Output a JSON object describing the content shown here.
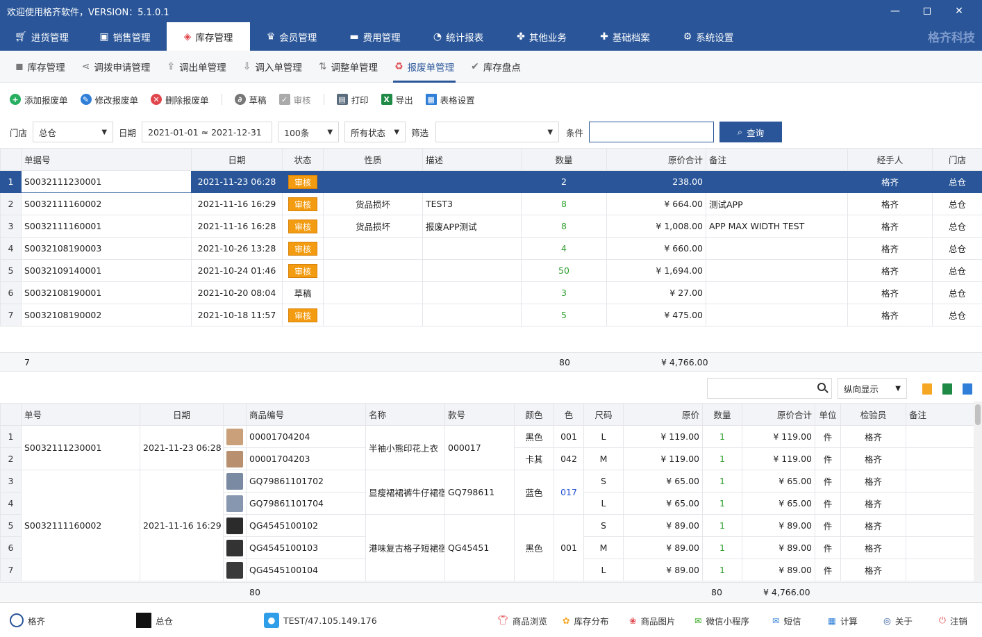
{
  "window": {
    "title": "欢迎使用格齐软件，VERSION：5.1.0.1",
    "brand": "格齐科技"
  },
  "main_nav": [
    {
      "label": "进货管理",
      "icon": "cart-icon"
    },
    {
      "label": "销售管理",
      "icon": "sales-icon"
    },
    {
      "label": "库存管理",
      "icon": "box-icon",
      "active": true
    },
    {
      "label": "会员管理",
      "icon": "member-icon"
    },
    {
      "label": "费用管理",
      "icon": "wallet-icon"
    },
    {
      "label": "统计报表",
      "icon": "pie-chart-icon"
    },
    {
      "label": "其他业务",
      "icon": "apps-icon"
    },
    {
      "label": "基础档案",
      "icon": "puzzle-icon"
    },
    {
      "label": "系统设置",
      "icon": "gear-icon"
    }
  ],
  "sub_nav": [
    {
      "label": "库存管理"
    },
    {
      "label": "调拨申请管理"
    },
    {
      "label": "调出单管理"
    },
    {
      "label": "调入单管理"
    },
    {
      "label": "调整单管理"
    },
    {
      "label": "报废单管理",
      "active": true
    },
    {
      "label": "库存盘点"
    }
  ],
  "toolbar": {
    "add": "添加报废单",
    "edit": "修改报废单",
    "delete": "删除报废单",
    "draft": "草稿",
    "audit": "审核",
    "print": "打印",
    "export": "导出",
    "table_settings": "表格设置"
  },
  "filters": {
    "store_label": "门店",
    "store_value": "总仓",
    "date_label": "日期",
    "date_value": "2021-01-01 ≈ 2021-12-31",
    "count_value": "100条",
    "status_value": "所有状态",
    "filter_label": "筛选",
    "filter_value": "",
    "condition_label": "条件",
    "condition_value": "",
    "query_button": "查询"
  },
  "orders": {
    "columns": [
      "单据号",
      "日期",
      "状态",
      "性质",
      "描述",
      "数量",
      "原价合计",
      "备注",
      "经手人",
      "门店"
    ],
    "rows": [
      {
        "no": "1",
        "id": "S0032111230001",
        "date": "2021-11-23 06:28",
        "status": "审核",
        "nature": "",
        "desc": "",
        "qty": "2",
        "total": "238.00",
        "remark": "",
        "handler": "格齐",
        "store": "总仓"
      },
      {
        "no": "2",
        "id": "S0032111160002",
        "date": "2021-11-16 16:29",
        "status": "审核",
        "nature": "货品损坏",
        "desc": "TEST3",
        "qty": "8",
        "total": "¥ 664.00",
        "remark": "测试APP",
        "handler": "格齐",
        "store": "总仓"
      },
      {
        "no": "3",
        "id": "S0032111160001",
        "date": "2021-11-16 16:28",
        "status": "审核",
        "nature": "货品损坏",
        "desc": "报废APP测试",
        "qty": "8",
        "total": "¥ 1,008.00",
        "remark": "APP MAX WIDTH TEST",
        "handler": "格齐",
        "store": "总仓"
      },
      {
        "no": "4",
        "id": "S0032108190003",
        "date": "2021-10-26 13:28",
        "status": "审核",
        "nature": "",
        "desc": "",
        "qty": "4",
        "total": "¥ 660.00",
        "remark": "",
        "handler": "格齐",
        "store": "总仓"
      },
      {
        "no": "5",
        "id": "S0032109140001",
        "date": "2021-10-24 01:46",
        "status": "审核",
        "nature": "",
        "desc": "",
        "qty": "50",
        "total": "¥ 1,694.00",
        "remark": "",
        "handler": "格齐",
        "store": "总仓"
      },
      {
        "no": "6",
        "id": "S0032108190001",
        "date": "2021-10-20 08:04",
        "status": "草稿",
        "nature": "",
        "desc": "",
        "qty": "3",
        "total": "¥ 27.00",
        "remark": "",
        "handler": "格齐",
        "store": "总仓"
      },
      {
        "no": "7",
        "id": "S0032108190002",
        "date": "2021-10-18 11:57",
        "status": "审核",
        "nature": "",
        "desc": "",
        "qty": "5",
        "total": "¥ 475.00",
        "remark": "",
        "handler": "格齐",
        "store": "总仓"
      }
    ],
    "summary": {
      "count": "7",
      "qty": "80",
      "total": "¥ 4,766.00"
    }
  },
  "detail": {
    "search_value": "",
    "view_mode": "纵向显示",
    "columns": [
      "单号",
      "日期",
      "商品编号",
      "名称",
      "款号",
      "颜色",
      "色",
      "尺码",
      "原价",
      "数量",
      "原价合计",
      "单位",
      "检验员",
      "备注"
    ],
    "groups": [
      {
        "order": "S0032111230001",
        "date": "2021-11-23 06:28"
      },
      {
        "order": "S0032111160002",
        "date": "2021-11-16 16:29"
      }
    ],
    "products": [
      {
        "name": "半袖小熊印花上衣",
        "style": "000017"
      },
      {
        "name": "显瘦裙裙裤牛仔裙宿",
        "style": "GQ798611"
      },
      {
        "name": "港味复古格子短裙宿",
        "style": "QG45451"
      }
    ],
    "colors": [
      {
        "color": "黑色",
        "code": "001"
      },
      {
        "color": "卡其",
        "code": "042"
      },
      {
        "color": "蓝色",
        "code": "017"
      },
      {
        "color": "黑色",
        "code": "001"
      }
    ],
    "rows": [
      {
        "no": "1",
        "sku": "00001704204",
        "size": "L",
        "price": "¥ 119.00",
        "qty": "1",
        "total": "¥ 119.00",
        "unit": "件",
        "inspector": "格齐"
      },
      {
        "no": "2",
        "sku": "00001704203",
        "size": "M",
        "price": "¥ 119.00",
        "qty": "1",
        "total": "¥ 119.00",
        "unit": "件",
        "inspector": "格齐"
      },
      {
        "no": "3",
        "sku": "GQ79861101702",
        "size": "S",
        "price": "¥ 65.00",
        "qty": "1",
        "total": "¥ 65.00",
        "unit": "件",
        "inspector": "格齐"
      },
      {
        "no": "4",
        "sku": "GQ79861101704",
        "size": "L",
        "price": "¥ 65.00",
        "qty": "1",
        "total": "¥ 65.00",
        "unit": "件",
        "inspector": "格齐"
      },
      {
        "no": "5",
        "sku": "QG4545100102",
        "size": "S",
        "price": "¥ 89.00",
        "qty": "1",
        "total": "¥ 89.00",
        "unit": "件",
        "inspector": "格齐"
      },
      {
        "no": "6",
        "sku": "QG4545100103",
        "size": "M",
        "price": "¥ 89.00",
        "qty": "1",
        "total": "¥ 89.00",
        "unit": "件",
        "inspector": "格齐"
      },
      {
        "no": "7",
        "sku": "QG4545100104",
        "size": "L",
        "price": "¥ 89.00",
        "qty": "1",
        "total": "¥ 89.00",
        "unit": "件",
        "inspector": "格齐"
      }
    ],
    "summary": {
      "sku_count": "80",
      "qty": "80",
      "total": "¥ 4,766.00"
    }
  },
  "statusbar": {
    "user": "格齐",
    "store": "总仓",
    "server": "TEST/47.105.149.176",
    "links": [
      "商品浏览",
      "库存分布",
      "商品图片",
      "微信小程序",
      "短信",
      "计算",
      "关于",
      "注销"
    ]
  },
  "colors": {
    "primary": "#2a5699",
    "badge": "#f39c12",
    "qty_green": "#2f9e2f"
  }
}
